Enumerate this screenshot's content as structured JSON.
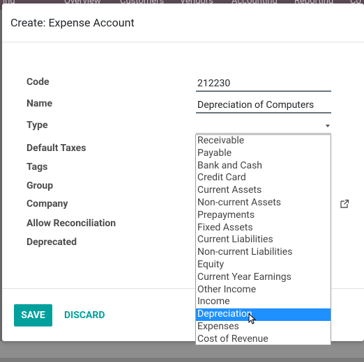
{
  "background": {
    "nav_items": [
      "ing",
      "Overview",
      "Customers",
      "Vendors",
      "Accounting",
      "Reporting",
      "Co"
    ]
  },
  "dialog": {
    "title": "Create: Expense Account",
    "fields": {
      "code": {
        "label": "Code",
        "value": "212230"
      },
      "name": {
        "label": "Name",
        "value": "Depreciation of Computers"
      },
      "type": {
        "label": "Type",
        "value": ""
      },
      "default_taxes": {
        "label": "Default Taxes"
      },
      "tags": {
        "label": "Tags"
      },
      "group": {
        "label": "Group"
      },
      "company": {
        "label": "Company"
      },
      "allow_reconciliation": {
        "label": "Allow Reconciliation"
      },
      "deprecated": {
        "label": "Deprecated"
      }
    },
    "type_options": [
      "Receivable",
      "Payable",
      "Bank and Cash",
      "Credit Card",
      "Current Assets",
      "Non-current Assets",
      "Prepayments",
      "Fixed Assets",
      "Current Liabilities",
      "Non-current Liabilities",
      "Equity",
      "Current Year Earnings",
      "Other Income",
      "Income",
      "Depreciation",
      "Expenses",
      "Cost of Revenue"
    ],
    "highlighted_option": "Depreciation",
    "buttons": {
      "save": "SAVE",
      "discard": "DISCARD"
    }
  },
  "colors": {
    "primary": "#00a09d",
    "highlight": "#1e90ff",
    "navbar": "#5a4a55"
  },
  "icons": {
    "external_link": "external-link-icon",
    "dropdown_caret": "caret-down-icon",
    "mouse_cursor": "mouse-pointer-icon"
  }
}
